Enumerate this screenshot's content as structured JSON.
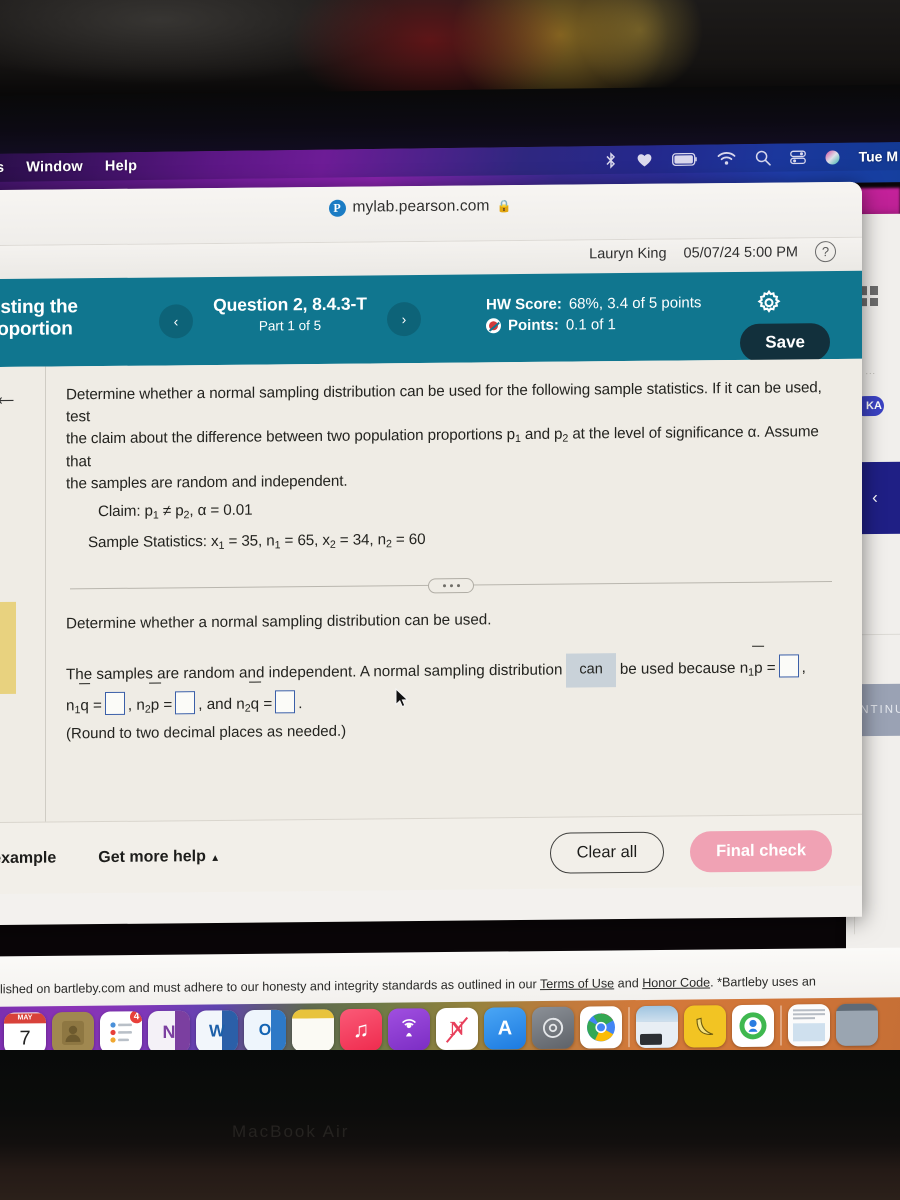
{
  "menubar": {
    "items": [
      "s",
      "Window",
      "Help"
    ],
    "status_icons": [
      "bluetooth-icon",
      "heart-icon",
      "battery-icon",
      "wifi-icon",
      "search-icon",
      "control-center-icon",
      "siri-icon"
    ],
    "clock": "Tue M"
  },
  "browser": {
    "url": "mylab.pearson.com",
    "favicon_letter": "P",
    "lock_icon": "lock-icon"
  },
  "user": {
    "name": "Lauryn King",
    "due": "05/07/24 5:00 PM",
    "help_icon": "question-mark-icon"
  },
  "app_header": {
    "title": "esting the\nroportion",
    "question_name": "Question 2, 8.4.3-T",
    "question_part": "Part 1 of 5",
    "hw_score_label": "HW Score:",
    "hw_score_value": "68%, 3.4 of 5 points",
    "points_label": "Points:",
    "points_value": "0.1 of 1",
    "save_label": "Save",
    "gear_icon": "gear-icon",
    "prev_icon": "chevron-left-icon",
    "next_icon": "chevron-right-icon",
    "accent_color": "#10768f",
    "save_bg": "#12303c"
  },
  "question": {
    "para_line1": "Determine whether a normal sampling distribution can be used for the following sample statistics. If it can be used, test",
    "para_line2a": "the claim about the difference between two population proportions p",
    "para_line2b": " and p",
    "para_line2c": " at the level of significance α. Assume that",
    "para_line3": "the samples are random and independent.",
    "claim_label": "Claim: p",
    "claim_mid": " ≠ p",
    "claim_tail": ", α = 0.01",
    "stats_label": "Sample Statistics: x",
    "stats_1": " = 35, n",
    "stats_2": " = 65, x",
    "stats_3": " = 34, n",
    "stats_4": " = 60"
  },
  "answer": {
    "prompt": "Determine whether a normal sampling distribution can be used.",
    "line_a": "The samples are random and independent. A normal sampling distribution",
    "dropdown_value": "can",
    "line_b": "be used because n",
    "n1p": "p =",
    "n1q": "q =",
    "n2p": "p =",
    "and_text": ", and n",
    "n2q": "q =",
    "note": "(Round to two decimal places as needed.)",
    "blank_count": 4
  },
  "footer": {
    "view_example": "n example",
    "get_more_help": "Get more help",
    "get_more_help_caret": "▲",
    "clear_all": "Clear all",
    "final_check": "Final check",
    "final_check_color": "#f0a2b4"
  },
  "background_window": {
    "grid_icon": "grid-four-icon",
    "faint_text": "d ...",
    "avatar_initials": "KA",
    "chevron": "‹",
    "continue_label": "CONTINUE"
  },
  "bartleby": {
    "text_start": "lished on bartleby.com and must adhere to our honesty and integrity standards as outlined in our ",
    "link1": "Terms of Use",
    "mid": " and ",
    "link2": "Honor Code",
    "text_end": ". *Bartleby uses an"
  },
  "dock": {
    "items": [
      {
        "name": "calendar-icon",
        "label": "7",
        "sub": "MAY",
        "bg": "#ffffff",
        "fg": "#d8413a"
      },
      {
        "name": "contacts-icon",
        "label": "",
        "bg": "#a08850",
        "fg": "#5e4c22"
      },
      {
        "name": "reminders-icon",
        "label": "",
        "bg": "#ffffff",
        "fg": "#4a90d9",
        "badge": "4"
      },
      {
        "name": "onenote-icon",
        "label": "N",
        "bg": "#f4f1f7",
        "fg": "#7b3fa0"
      },
      {
        "name": "word-icon",
        "label": "W",
        "bg": "#f2f6fb",
        "fg": "#1d5fa8"
      },
      {
        "name": "outlook-icon",
        "label": "O",
        "bg": "#eef5fc",
        "fg": "#1464b3"
      },
      {
        "name": "notes-icon",
        "label": "",
        "bg": "#f7f5ef",
        "fg": "#e8c33c"
      },
      {
        "name": "music-icon",
        "label": "♫",
        "bg": "#f2355a",
        "fg": "#ffffff"
      },
      {
        "name": "podcasts-icon",
        "label": "",
        "bg": "#8a3ed0",
        "fg": "#ffffff"
      },
      {
        "name": "news-icon",
        "label": "N",
        "bg": "#ffffff",
        "fg": "#e8405c"
      },
      {
        "name": "app-store-icon",
        "label": "A",
        "bg": "#2e8ef0",
        "fg": "#ffffff"
      },
      {
        "name": "system-settings-icon",
        "label": "",
        "bg": "#6f7378",
        "fg": "#d8dade"
      },
      {
        "name": "chrome-icon",
        "label": "",
        "bg": "#ffffff",
        "fg": "#4285f4",
        "dot": true
      },
      {
        "name": "separator",
        "label": "",
        "sep": true
      },
      {
        "name": "photo-thumbnail-icon",
        "label": "",
        "bg": "#8ea9c4",
        "fg": "#ffffff",
        "dot": true
      },
      {
        "name": "banana-icon",
        "label": "",
        "bg": "#f2c423",
        "fg": "#e8d36a"
      },
      {
        "name": "find-my-icon",
        "label": "",
        "bg": "#3fb84f",
        "fg": "#ffffff"
      },
      {
        "name": "separator",
        "label": "",
        "sep": true
      },
      {
        "name": "document-icon",
        "label": "",
        "bg": "#fbfbfb",
        "fg": "#9aa2ad"
      },
      {
        "name": "finder-window-icon",
        "label": "",
        "bg": "#7f8a96",
        "fg": "#ffffff"
      }
    ]
  },
  "device": {
    "brand": "MacBook Air"
  }
}
